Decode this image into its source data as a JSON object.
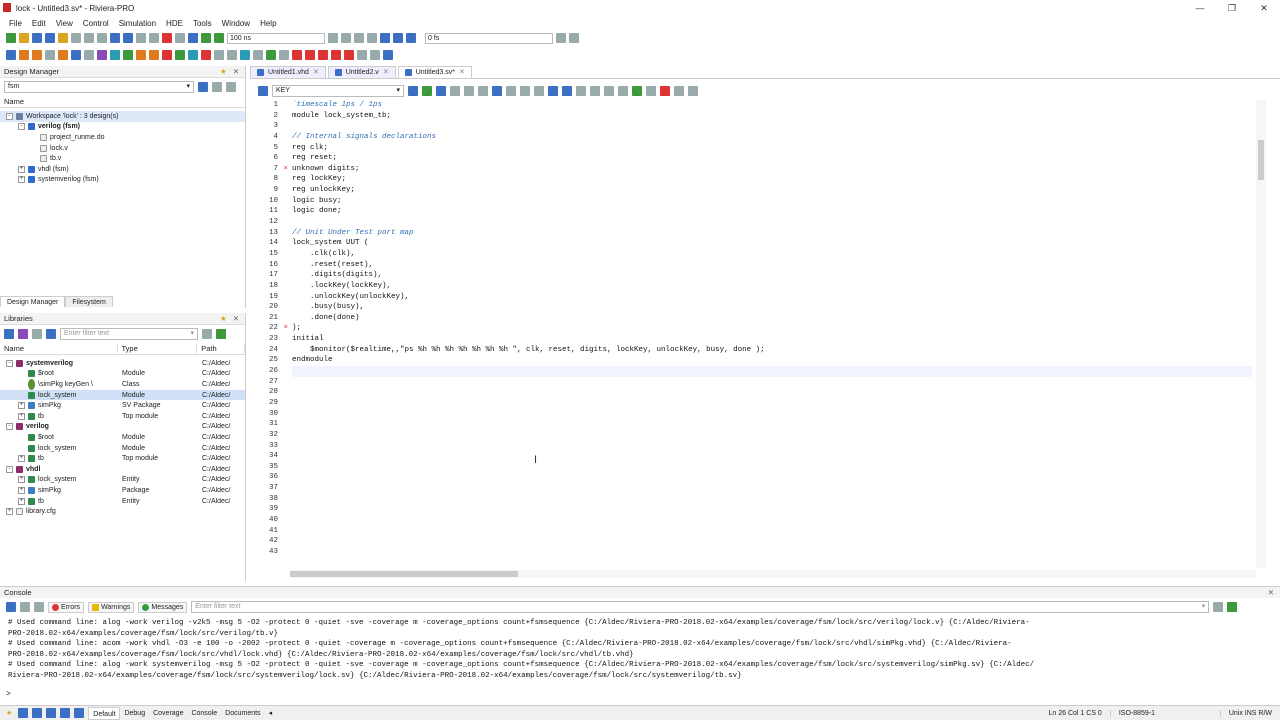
{
  "window": {
    "title": "lock - Untitled3.sv* - Riviera-PRO"
  },
  "menu": [
    "File",
    "Edit",
    "View",
    "Control",
    "Simulation",
    "HDE",
    "Tools",
    "Window",
    "Help"
  ],
  "toolbar": {
    "sim_time": "100 ns",
    "time_field": "0 fs"
  },
  "design_manager": {
    "title": "Design Manager",
    "filter_value": "fsm",
    "column_name": "Name",
    "tree": [
      {
        "label": "Workspace 'lock' : 3 design(s)",
        "level": 0,
        "icon": "workspace-icon",
        "exp": "-"
      },
      {
        "label": "verilog (fsm)",
        "level": 1,
        "icon": "design-icon",
        "exp": "-",
        "bold": true
      },
      {
        "label": "project_runme.do",
        "level": 2,
        "icon": "file-icon",
        "exp": ""
      },
      {
        "label": "lock.v",
        "level": 2,
        "icon": "file-icon",
        "exp": ""
      },
      {
        "label": "tb.v",
        "level": 2,
        "icon": "file-icon",
        "exp": ""
      },
      {
        "label": "vhdl (fsm)",
        "level": 1,
        "icon": "design-icon",
        "exp": "+"
      },
      {
        "label": "systemverilog (fsm)",
        "level": 1,
        "icon": "design-icon",
        "exp": "+"
      }
    ],
    "tabs": [
      "Design Manager",
      "Filesystem"
    ]
  },
  "libraries": {
    "title": "Libraries",
    "filter_placeholder": "Enter filter text",
    "columns": [
      "Name",
      "Type",
      "Path"
    ],
    "rows": [
      {
        "name": "systemverilog",
        "type": "",
        "path": "C:/Aldec/",
        "level": 0,
        "exp": "-",
        "icon": "library-icon"
      },
      {
        "name": "$root",
        "type": "Module",
        "path": "C:/Aldec/",
        "level": 1,
        "exp": "",
        "icon": "module-icon"
      },
      {
        "name": "\\simPkg keyGen \\",
        "type": "Class",
        "path": "C:/Aldec/",
        "level": 1,
        "exp": "",
        "icon": "class-icon"
      },
      {
        "name": "lock_system",
        "type": "Module",
        "path": "C:/Aldec/",
        "level": 1,
        "exp": "",
        "icon": "module-icon",
        "selected": true
      },
      {
        "name": "simPkg",
        "type": "SV Package",
        "path": "C:/Aldec/",
        "level": 1,
        "exp": "+",
        "icon": "package-icon"
      },
      {
        "name": "tb",
        "type": "Top module",
        "path": "C:/Aldec/",
        "level": 1,
        "exp": "+",
        "icon": "module-icon"
      },
      {
        "name": "verilog",
        "type": "",
        "path": "C:/Aldec/",
        "level": 0,
        "exp": "-",
        "icon": "library-icon"
      },
      {
        "name": "$root",
        "type": "Module",
        "path": "C:/Aldec/",
        "level": 1,
        "exp": "",
        "icon": "module-icon"
      },
      {
        "name": "lock_system",
        "type": "Module",
        "path": "C:/Aldec/",
        "level": 1,
        "exp": "",
        "icon": "module-icon"
      },
      {
        "name": "tb",
        "type": "Top module",
        "path": "C:/Aldec/",
        "level": 1,
        "exp": "+",
        "icon": "module-icon"
      },
      {
        "name": "vhdl",
        "type": "",
        "path": "C:/Aldec/",
        "level": 0,
        "exp": "-",
        "icon": "library-icon"
      },
      {
        "name": "lock_system",
        "type": "Entity",
        "path": "C:/Aldec/",
        "level": 1,
        "exp": "+",
        "icon": "module-icon"
      },
      {
        "name": "simPkg",
        "type": "Package",
        "path": "C:/Aldec/",
        "level": 1,
        "exp": "+",
        "icon": "package-icon"
      },
      {
        "name": "tb",
        "type": "Entity",
        "path": "C:/Aldec/",
        "level": 1,
        "exp": "+",
        "icon": "module-icon"
      },
      {
        "name": "library.cfg",
        "type": "",
        "path": "",
        "level": 0,
        "exp": "+",
        "icon": "file-icon"
      }
    ]
  },
  "editor": {
    "tabs": [
      {
        "label": "Untitled1.vhd",
        "active": false
      },
      {
        "label": "Untitled2.v",
        "active": false
      },
      {
        "label": "Untitled3.sv*",
        "active": true
      }
    ],
    "keyword_box": "KEY",
    "lines": [
      "`timescale 1ps / 1ps",
      "module lock_system_tb;",
      "",
      "// Internal signals declarations",
      "reg clk;",
      "reg reset;",
      "unknown digits;",
      "reg lockKey;",
      "reg unlockKey;",
      "logic busy;",
      "logic done;",
      "",
      "// Unit Under Test port map",
      "lock_system UUT (",
      "    .clk(clk),",
      "    .reset(reset),",
      "    .digits(digits),",
      "    .lockKey(lockKey),",
      "    .unlockKey(unlockKey),",
      "    .busy(busy),",
      "    .done(done)",
      ");",
      "initial",
      "    $monitor($realtime,,\"ps %h %h %h %h %h %h %h \", clk, reset, digits, lockKey, unlockKey, busy, done );",
      "endmodule",
      "",
      "",
      "",
      "",
      "",
      "",
      "",
      "",
      "",
      "",
      "",
      "",
      "",
      "",
      "",
      "",
      "",
      ""
    ],
    "error_lines": [
      7,
      22
    ]
  },
  "console": {
    "title": "Console",
    "buttons": {
      "errors": "Errors",
      "warnings": "Warnings",
      "messages": "Messages"
    },
    "filter_placeholder": "Enter filter text",
    "lines": [
      "# Used command line: alog -work verilog -v2k5 -msg 5 -O2 -protect 0 -quiet -sve -coverage m -coverage_options count+fsmsequence {C:/Aldec/Riviera-PRO-2018.02-x64/examples/coverage/fsm/lock/src/verilog/lock.v} {C:/Aldec/Riviera-",
      "PRO-2018.02-x64/examples/coverage/fsm/lock/src/verilog/tb.v}",
      "# Used command line: acom -work vhdl -O3 -e 100 -o -2002 -protect 0 -quiet -coverage m -coverage_options count+fsmsequence {C:/Aldec/Riviera-PRO-2018.02-x64/examples/coverage/fsm/lock/src/vhdl/simPkg.vhd} {C:/Aldec/Riviera-",
      "PRO-2018.02-x64/examples/coverage/fsm/lock/src/vhdl/lock.vhd} {C:/Aldec/Riviera-PRO-2018.02-x64/examples/coverage/fsm/lock/src/vhdl/tb.vhd}",
      "# Used command line: alog -work systemverilog -msg 5 -O2 -protect 0 -quiet -sve -coverage m -coverage_options count+fsmsequence {C:/Aldec/Riviera-PRO-2018.02-x64/examples/coverage/fsm/lock/src/systemverilog/simPkg.sv} {C:/Aldec/",
      "Riviera-PRO-2018.02-x64/examples/coverage/fsm/lock/src/systemverilog/lock.sv} {C:/Aldec/Riviera-PRO-2018.02-x64/examples/coverage/fsm/lock/src/systemverilog/tb.sv}"
    ],
    "prompt": ">"
  },
  "statusbar": {
    "tabs": [
      "Default",
      "Debug",
      "Coverage",
      "Console",
      "Documents"
    ],
    "position": "Ln 26 Col 1 CS 0",
    "encoding": "ISO-8859-1",
    "mode": "Unix INS R/W"
  }
}
